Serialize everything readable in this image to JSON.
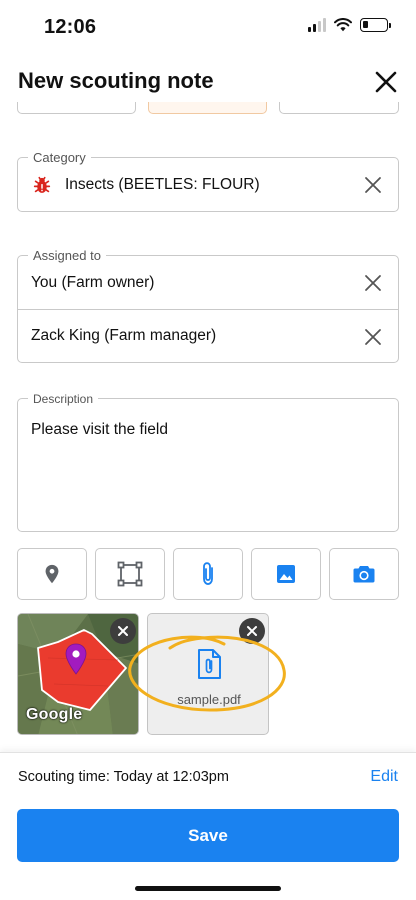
{
  "status_bar": {
    "time": "12:06",
    "icons": [
      "signal-icon",
      "wifi-icon",
      "battery-icon"
    ]
  },
  "header": {
    "title": "New scouting note",
    "close_icon": "close-icon"
  },
  "category": {
    "legend": "Category",
    "icon": "bug-icon",
    "value": "Insects (BEETLES: FLOUR)"
  },
  "assigned_to": {
    "legend": "Assigned to",
    "people": [
      {
        "name": "You (Farm owner)"
      },
      {
        "name": "Zack King (Farm manager)"
      }
    ]
  },
  "description": {
    "legend": "Description",
    "value": "Please visit the field"
  },
  "tools": [
    {
      "icon": "location-pin-icon"
    },
    {
      "icon": "draw-area-icon"
    },
    {
      "icon": "attachment-icon"
    },
    {
      "icon": "image-icon"
    },
    {
      "icon": "camera-icon"
    }
  ],
  "attachments": {
    "map_label": "Google",
    "file_name": "sample.pdf",
    "file_icon": "file-icon"
  },
  "footer": {
    "scouting_time": "Scouting time: Today at 12:03pm",
    "edit_label": "Edit",
    "save_label": "Save"
  },
  "colors": {
    "accent": "#1a82f0",
    "category_icon": "#d9251d",
    "field_polygon": "#ea3b2e",
    "marker": "#a21bbf",
    "highlight": "#f2b01e"
  }
}
